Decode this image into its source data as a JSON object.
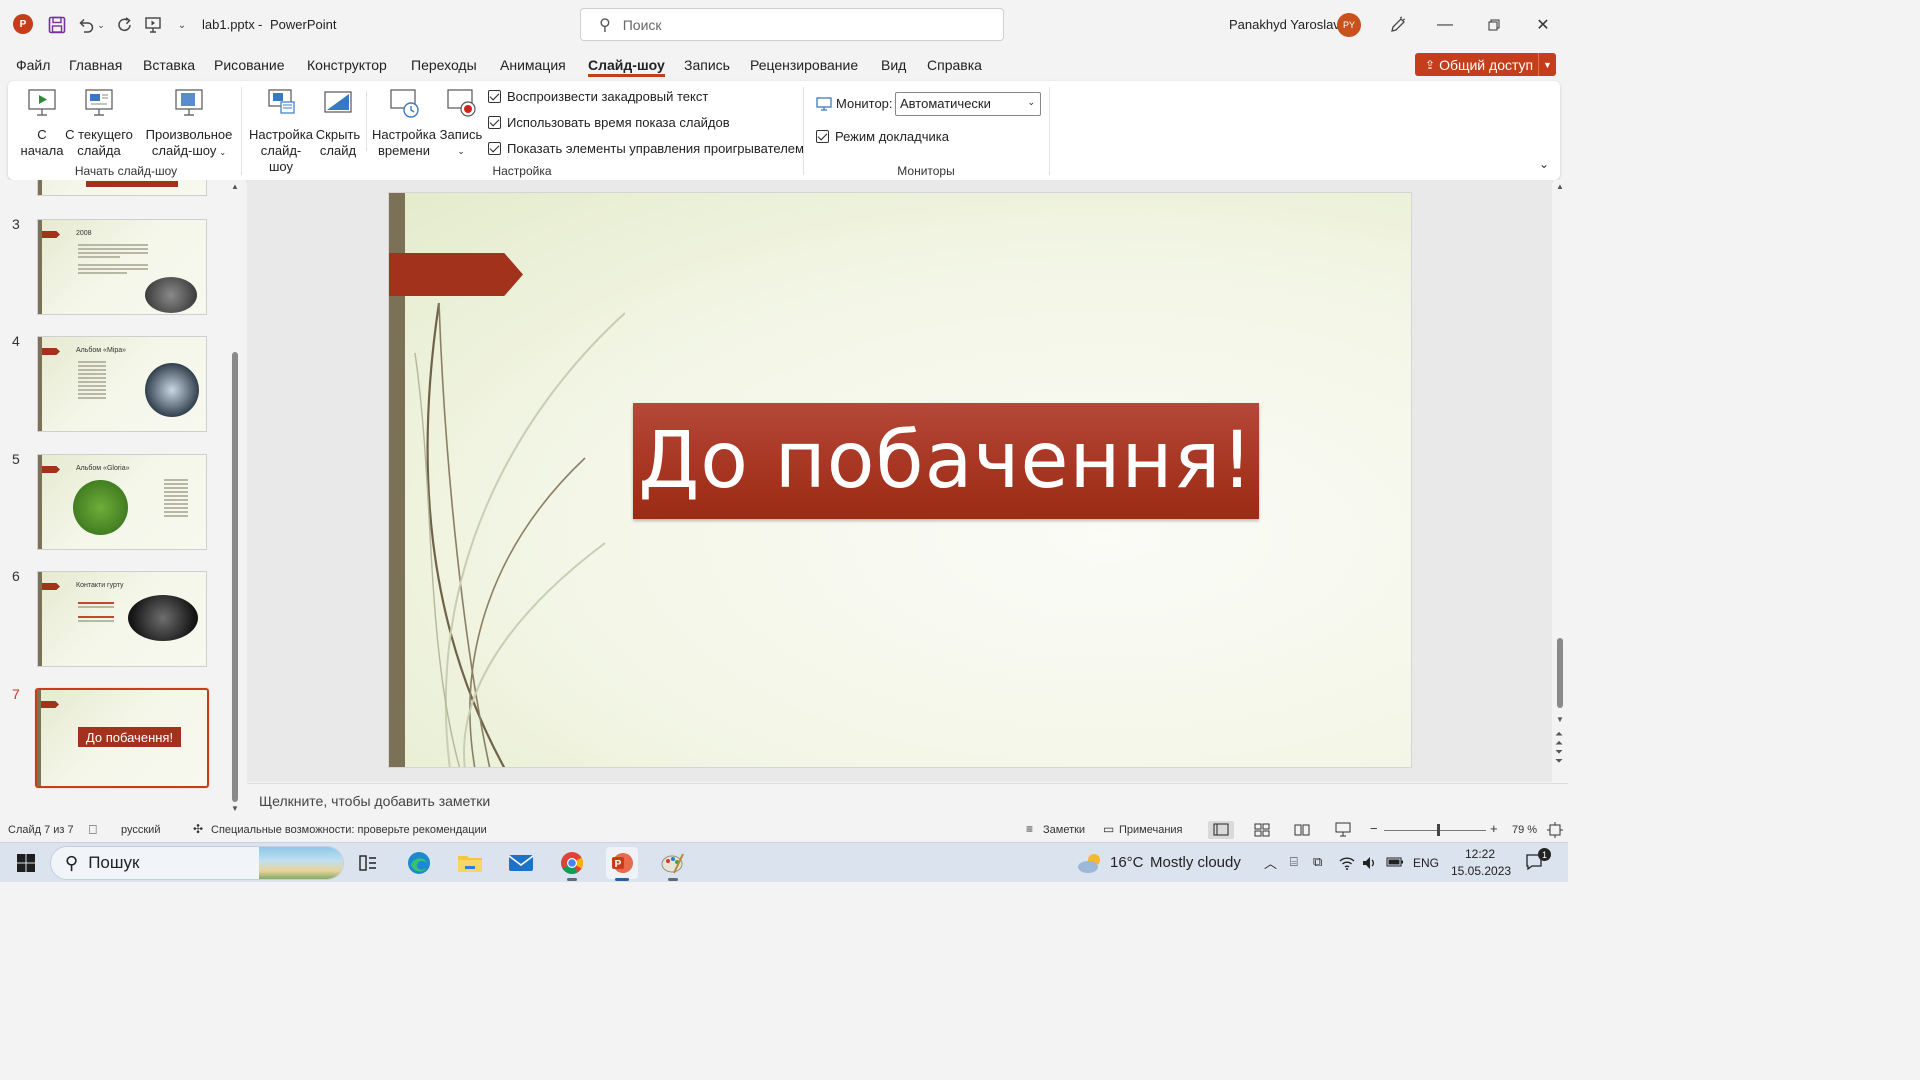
{
  "app": {
    "filename": "lab1.pptx",
    "separator": "-",
    "app_name": "PowerPoint",
    "logo_letter": "P",
    "search_placeholder": "Поиск",
    "user_name": "Panakhyd Yaroslav",
    "user_initials": "PY",
    "accent_color": "#c43e1c"
  },
  "menu": {
    "tabs": [
      "Файл",
      "Главная",
      "Вставка",
      "Рисование",
      "Конструктор",
      "Переходы",
      "Анимация",
      "Слайд-шоу",
      "Запись",
      "Рецензирование",
      "Вид",
      "Справка"
    ],
    "active_tab": "Слайд-шоу",
    "share_label": "Общий доступ"
  },
  "ribbon": {
    "start_group": {
      "label": "Начать слайд-шоу",
      "from_start": [
        "С",
        "начала"
      ],
      "from_current": [
        "С текущего",
        "слайда"
      ],
      "custom": [
        "Произвольное",
        "слайд-шоу"
      ]
    },
    "setup_group": {
      "label": "Настройка",
      "setup_show": [
        "Настройка",
        "слайд-шоу"
      ],
      "hide_slide": [
        "Скрыть",
        "слайд"
      ],
      "rehearse": [
        "Настройка",
        "времени"
      ],
      "record": [
        "Запись"
      ],
      "play_narrations": "Воспроизвести закадровый текст",
      "use_timings": "Использовать время показа слайдов",
      "show_media_controls": "Показать элементы управления проигрывателем"
    },
    "monitors_group": {
      "label": "Мониторы",
      "monitor_label": "Монитор:",
      "monitor_value": "Автоматически",
      "presenter_view": "Режим докладчика"
    }
  },
  "thumbnails": [
    {
      "num": "3",
      "title": "2008"
    },
    {
      "num": "4",
      "title": "Альбом «Міра»"
    },
    {
      "num": "5",
      "title": "Альбом «Gloria»"
    },
    {
      "num": "6",
      "title": "Контакти гурту"
    },
    {
      "num": "7",
      "title": "До побачення!"
    }
  ],
  "slide": {
    "title": "До побачення!"
  },
  "notes": {
    "placeholder": "Щелкните, чтобы добавить заметки"
  },
  "statusbar": {
    "slide_info": "Слайд 7 из 7",
    "language": "русский",
    "accessibility": "Специальные возможности: проверьте рекомендации",
    "notes_btn": "Заметки",
    "comments_btn": "Примечания",
    "zoom_level": "79 %",
    "zoom_fraction": 0.52
  },
  "taskbar": {
    "search_label": "Пошук",
    "weather_temp": "16°C",
    "weather_desc": "Mostly cloudy",
    "lang": "ENG",
    "time": "12:22",
    "date": "15.05.2023",
    "notif_count": "1"
  }
}
